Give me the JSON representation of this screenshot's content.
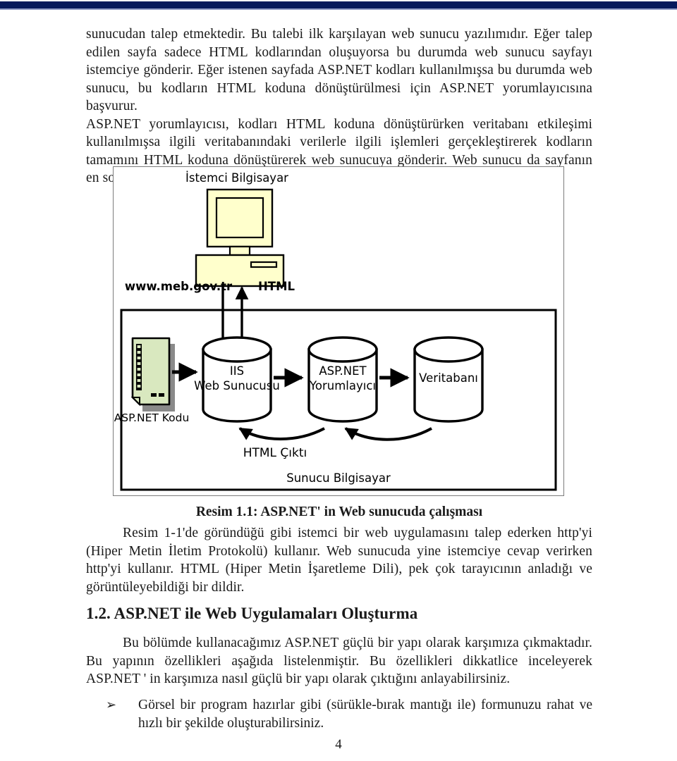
{
  "document": {
    "page_number": "4",
    "accent_color": "#061a5c",
    "paragraph_1": "sunucudan talep etmektedir. Bu talebi ilk karşılayan web sunucu yazılımıdır. Eğer talep edilen sayfa sadece HTML kodlarından oluşuyorsa bu durumda web sunucu sayfayı istemciye gönderir. Eğer istenen sayfada ASP.NET kodları kullanılmışsa bu durumda web sunucu, bu kodların HTML koduna dönüştürülmesi için ASP.NET yorumlayıcısına başvurur.",
    "paragraph_2": "ASP.NET yorumlayıcısı, kodları HTML koduna dönüştürürken veritabanı etkileşimi kullanılmışsa ilgili veritabanındaki verilerle ilgili işlemleri gerçekleştirerek kodların tamamını HTML koduna dönüştürerek web sunucuya gönderir. Web sunucu da sayfanın en son halini ama yine HTML hâlini istemciye gönderir.",
    "figure_caption": "Resim 1.1: ASP.NET' in Web sunucuda çalışması",
    "paragraph_3": "Resim 1-1'de göründüğü gibi istemci bir web uygulamasını talep ederken http'yi (Hiper Metin İletim Protokolü) kullanır. Web sunucuda yine istemciye cevap verirken http'yi kullanır. HTML (Hiper Metin İşaretleme Dili), pek çok tarayıcının anladığı ve görüntüleyebildiği bir dildir.",
    "section_heading": "1.2. ASP.NET ile Web Uygulamaları Oluşturma",
    "paragraph_4": "Bu bölümde kullanacağımız ASP.NET güçlü bir yapı olarak karşımıza çıkmaktadır. Bu yapının özellikleri aşağıda listelenmiştir. Bu özellikleri dikkatlice inceleyerek ASP.NET ' in karşımıza nasıl güçlü bir yapı olarak çıktığını anlayabilirsiniz.",
    "bullets": [
      {
        "marker": "➢",
        "text": "Görsel bir program hazırlar gibi (sürükle-bırak mantığı ile) formunuzu rahat ve hızlı bir şekilde oluşturabilirsiniz."
      }
    ]
  },
  "figure": {
    "client_label": "İstemci Bilgisayar",
    "request_label": "www.meb.gov.tr",
    "response_label": "HTML",
    "code_label": "ASP.NET Kodu",
    "node_iis_line1": "IIS",
    "node_iis_line2": "Web Sunucusu",
    "node_interpreter_line1": "ASP.NET",
    "node_interpreter_line2": "Yorumlayıcı",
    "node_database": "Veritabanı",
    "html_output_label": "HTML Çıktı",
    "server_label": "Sunucu Bilgisayar",
    "colors": {
      "monitor_fill": "#FFFFCC",
      "code_fill": "#D9E8BF",
      "code_shadow": "#8a8a8a",
      "stroke": "#000000",
      "cylinder_fill": "#FFFFFF"
    }
  }
}
